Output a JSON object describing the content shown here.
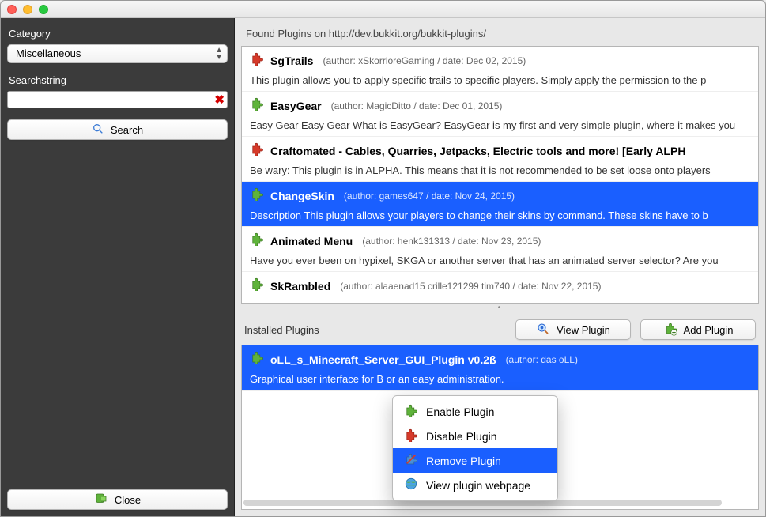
{
  "sidebar": {
    "category_label": "Category",
    "category_value": "Miscellaneous",
    "searchstring_label": "Searchstring",
    "search_value": "",
    "search_button": "Search",
    "close_button": "Close"
  },
  "main": {
    "found_label": "Found Plugins on http://dev.bukkit.org/bukkit-plugins/",
    "installed_label": "Installed Plugins",
    "view_plugin_button": "View Plugin",
    "add_plugin_button": "Add Plugin"
  },
  "found_plugins": [
    {
      "name": "SgTrails",
      "author": "xSkorrloreGaming",
      "date": "Dec 02, 2015",
      "color": "red",
      "desc": "This plugin allows you to apply specific trails to specific players. Simply apply the permission to the p"
    },
    {
      "name": "EasyGear",
      "author": "MagicDitto",
      "date": "Dec 01, 2015",
      "color": "green",
      "desc": "Easy Gear Easy Gear What is EasyGear? EasyGear is my first and very simple plugin, where it makes you"
    },
    {
      "name": "Craftomated - Cables, Quarries, Jetpacks, Electric tools and more! [Early ALPH",
      "author": "",
      "date": "",
      "color": "red",
      "desc": "Be wary: This plugin is in ALPHA. This means that it is not recommended to be set loose onto players"
    },
    {
      "name": "ChangeSkin",
      "author": "games647",
      "date": "Nov 24, 2015",
      "color": "green",
      "selected": true,
      "desc": "Description This plugin allows your players to change their skins by command. These skins have to b"
    },
    {
      "name": "Animated Menu",
      "author": "henk131313",
      "date": "Nov 23, 2015",
      "color": "green",
      "desc": "Have you ever been on hypixel, SKGA or another server that has an animated server selector? Are you "
    },
    {
      "name": "SkRambled",
      "author": "alaaenad15 crille121299 tim740",
      "date": "Nov 22, 2015",
      "color": "green",
      "desc": ""
    }
  ],
  "installed_plugins": [
    {
      "name": "oLL_s_Minecraft_Server_GUI_Plugin v0.2ß",
      "author": "das oLL",
      "color": "green",
      "selected": true,
      "desc": "Graphical user interface for B                                                            or an easy administration."
    }
  ],
  "context_menu": {
    "items": [
      {
        "label": "Enable Plugin",
        "icon": "green"
      },
      {
        "label": "Disable Plugin",
        "icon": "red"
      },
      {
        "label": "Remove Plugin",
        "icon": "remove",
        "selected": true
      },
      {
        "label": "View plugin webpage",
        "icon": "globe"
      }
    ]
  }
}
